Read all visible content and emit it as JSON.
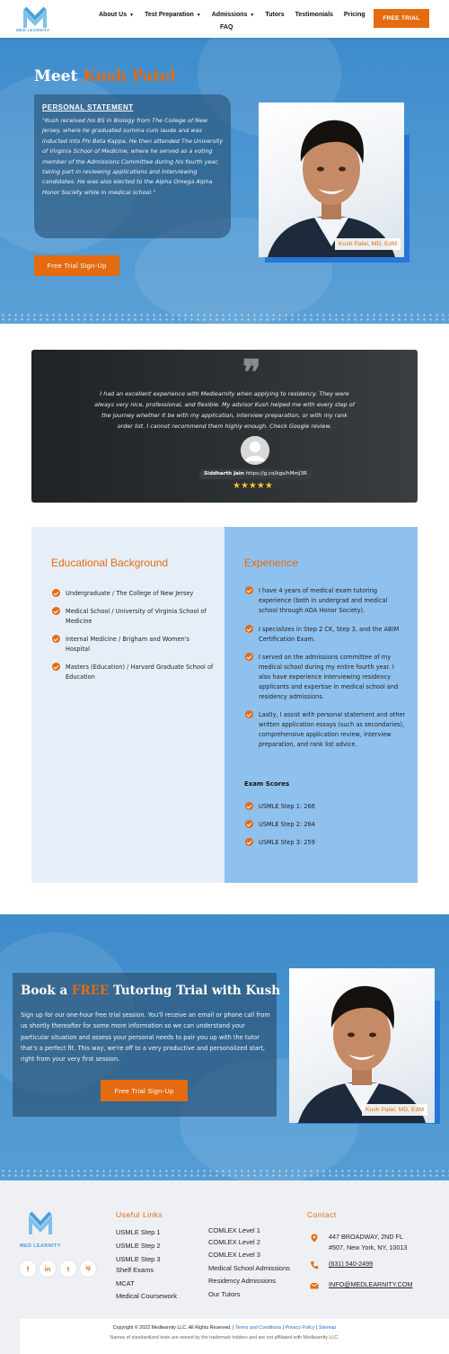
{
  "brand": {
    "name": "MED LEARNITY",
    "accent_color": "#e46b10",
    "blue_color": "#4a9fd9"
  },
  "nav": {
    "items": [
      {
        "label": "About Us",
        "has_dropdown": true
      },
      {
        "label": "Test Preparation",
        "has_dropdown": true
      },
      {
        "label": "Admissions",
        "has_dropdown": true
      },
      {
        "label": "Tutors",
        "has_dropdown": false
      },
      {
        "label": "Testimonials",
        "has_dropdown": false
      },
      {
        "label": "Pricing",
        "has_dropdown": false
      }
    ],
    "faq": "FAQ",
    "cta": "FREE TRIAL"
  },
  "hero": {
    "title_prefix": "Meet ",
    "title_name": "Kush Patel",
    "statement_heading": "PERSONAL STATEMENT",
    "statement_text": "\"Kush received his BS in Biology from The College of New Jersey, where he graduated summa cum laude and was inducted into Phi Beta Kappa. He then attended The University of Virginia School of Medicine, where he served as a voting member of the Admissions Committee during his fourth year, taking part in reviewing applications and interviewing candidates. He was also elected to the Alpha Omega Alpha Honor Society while in medical school.\"",
    "cta": "Free Trial Sign-Up",
    "photo_caption": "Kush Patel, MD, EdM"
  },
  "testimonial": {
    "text": "I had an excellent experience with Medlearnity when applying to residency. They were always very nice, professional, and flexible. My advisor Kush helped me with every step of the journey whether it be with my application, interview preparation, or with my rank order list. I cannot recommend them highly enough. Check Google review.",
    "reviewer_name": "Siddharth Jain",
    "reviewer_link": "https://g.co/kgs/hMmJ3R",
    "rating": 5,
    "stars": "★★★★★"
  },
  "education": {
    "title": "Educational Background",
    "items": [
      "Undergraduate / The College of New Jersey",
      "Medical School / University of Virginia School of Medicine",
      "Internal Medicine / Brigham and Women's Hospital",
      "Masters (Education) / Harvard Graduate School of Education"
    ]
  },
  "experience": {
    "title": "Experience",
    "items": [
      "I have 4 years of medical exam tutoring experience (both in undergrad and medical school through AOA Honor Society).",
      "I specializes in Step 2 CK, Step 3, and the ABIM Certification Exam.",
      "I served on the admissions committee of my medical school during my entire fourth year. I also have experience interviewing residency applicants and expertise in medical school and residency admissions.",
      "Lastly, I assist with personal statement and other written application essays (such as secondaries), comprehensive application review, interview preparation, and rank list advice."
    ],
    "scores_heading": "Exam Scores",
    "scores": [
      "USMLE Step 1: 266",
      "USMLE Step 2: 264",
      "USMLE Step 3: 259"
    ]
  },
  "book": {
    "title_pre": "Book a ",
    "title_free": "FREE",
    "title_post": " Tutoring Trial with Kush",
    "text": "Sign up for our one-hour free trial session. You'll receive an email or phone call from us shortly thereafter for some more information so we can understand your particular situation and assess your personal needs to pair you up with the tutor that's a perfect fit. This way, we're off to a very productive and personalized start, right from your very first session.",
    "cta": "Free Trial Sign-Up",
    "photo_caption": "Kush Patel, MD, EdM"
  },
  "footer": {
    "logo_text": "MED LEARNITY",
    "social": [
      "f",
      "in",
      "t",
      "ig"
    ],
    "useful_links_heading": "Useful Links",
    "links_col1": [
      "USMLE Step 1",
      "USMLE Step 2",
      "USMLE Step 3",
      "Shelf Exams",
      "MCAT",
      "Medical Coursework"
    ],
    "links_col2": [
      "COMLEX Level 1",
      "COMLEX Level 2",
      "COMLEX Level 3",
      "Medical School Admissions",
      "Residency Admissions",
      "Our Tutors"
    ],
    "contact_heading": "Contact",
    "address_line1": "447 BROADWAY, 2ND FL",
    "address_line2": "#507, New York, NY, 10013",
    "phone": "(631) 540-2499",
    "email": "INFO@MEDLEARNITY.COM",
    "copyright": "Copyright © 2023 Medlearnity LLC. All Rights Reserved. |",
    "terms": "Terms and Conditions",
    "privacy": "Privacy Policy",
    "sitemap": "Sitemap",
    "disclaimer": "Names of standardized tests are owned by the trademark holders and are not affiliated with Medlearnity LLC."
  }
}
